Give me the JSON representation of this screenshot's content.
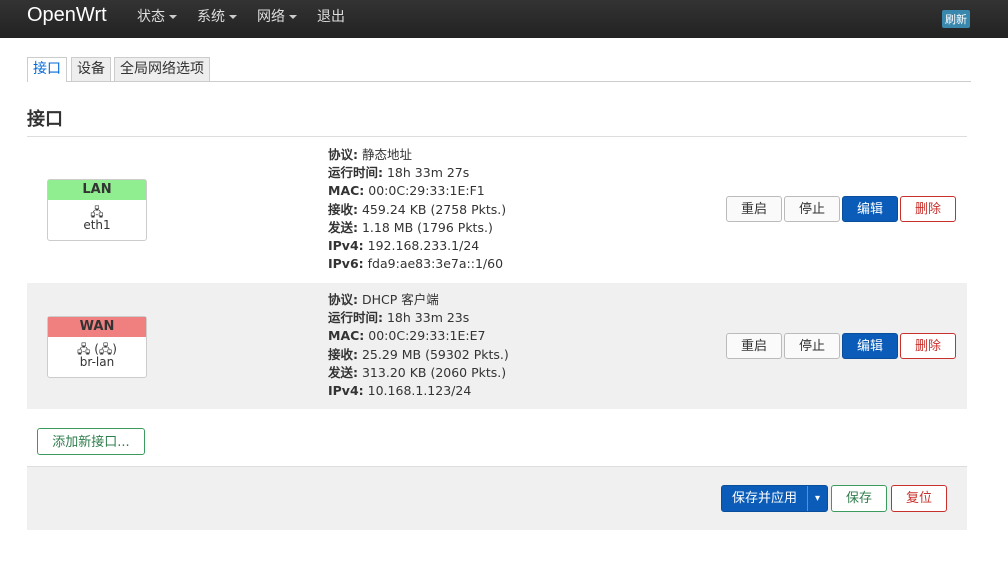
{
  "header": {
    "brand": "OpenWrt",
    "nav": [
      {
        "label": "状态",
        "dropdown": true
      },
      {
        "label": "系统",
        "dropdown": true
      },
      {
        "label": "网络",
        "dropdown": true
      },
      {
        "label": "退出",
        "dropdown": false
      }
    ],
    "refresh_label": "刷新"
  },
  "tabs": [
    {
      "label": "接口",
      "active": true
    },
    {
      "label": "设备",
      "active": false
    },
    {
      "label": "全局网络选项",
      "active": false
    }
  ],
  "page_title": "接口",
  "interfaces": [
    {
      "name": "LAN",
      "header_color": "#90ee90",
      "icon_text": "🖧",
      "device": "eth1",
      "info": [
        {
          "label": "协议:",
          "value": "静态地址"
        },
        {
          "label": "运行时间:",
          "value": "18h 33m 27s"
        },
        {
          "label": "MAC:",
          "value": "00:0C:29:33:1E:F1"
        },
        {
          "label": "接收:",
          "value": "459.24 KB (2758 Pkts.)"
        },
        {
          "label": "发送:",
          "value": "1.18 MB (1796 Pkts.)"
        },
        {
          "label": "IPv4:",
          "value": "192.168.233.1/24"
        },
        {
          "label": "IPv6:",
          "value": "fda9:ae83:3e7a::1/60"
        }
      ]
    },
    {
      "name": "WAN",
      "header_color": "#f08080",
      "icon_text": "🖧 (🖧)",
      "device": "br-lan",
      "info": [
        {
          "label": "协议:",
          "value": "DHCP 客户端"
        },
        {
          "label": "运行时间:",
          "value": "18h 33m 23s"
        },
        {
          "label": "MAC:",
          "value": "00:0C:29:33:1E:E7"
        },
        {
          "label": "接收:",
          "value": "25.29 MB (59302 Pkts.)"
        },
        {
          "label": "发送:",
          "value": "313.20 KB (2060 Pkts.)"
        },
        {
          "label": "IPv4:",
          "value": "10.168.1.123/24"
        }
      ]
    }
  ],
  "row_buttons": {
    "restart": "重启",
    "stop": "停止",
    "edit": "编辑",
    "delete": "删除"
  },
  "add_interface_label": "添加新接口...",
  "footer": {
    "save_apply": "保存并应用",
    "save_apply_caret": "▾",
    "save": "保存",
    "reset": "复位"
  }
}
